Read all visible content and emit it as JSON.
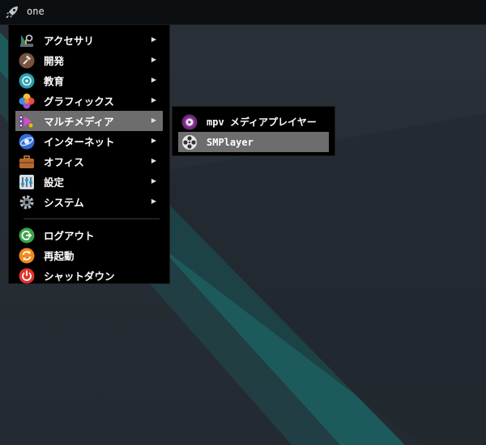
{
  "panel": {
    "launcher_icon": "rocket-icon",
    "label": "one"
  },
  "colors": {
    "menu_bg": "#000000",
    "highlight": "#6d6d6d",
    "desktop_bg": "#262d35",
    "stripe": "#1d5a5c"
  },
  "menu": {
    "items": [
      {
        "label": "アクセサリ",
        "icon": "accessories-icon",
        "submenu": true
      },
      {
        "label": "開発",
        "icon": "development-icon",
        "submenu": true
      },
      {
        "label": "教育",
        "icon": "education-icon",
        "submenu": true
      },
      {
        "label": "グラフィックス",
        "icon": "graphics-icon",
        "submenu": true
      },
      {
        "label": "マルチメディア",
        "icon": "multimedia-icon",
        "submenu": true,
        "highlighted": true
      },
      {
        "label": "インターネット",
        "icon": "internet-icon",
        "submenu": true
      },
      {
        "label": "オフィス",
        "icon": "office-icon",
        "submenu": true
      },
      {
        "label": "設定",
        "icon": "settings-icon",
        "submenu": true
      },
      {
        "label": "システム",
        "icon": "system-icon",
        "submenu": true
      }
    ],
    "actions": [
      {
        "label": "ログアウト",
        "icon": "logout-icon"
      },
      {
        "label": "再起動",
        "icon": "restart-icon"
      },
      {
        "label": "シャットダウン",
        "icon": "shutdown-icon"
      }
    ],
    "arrow": "▶"
  },
  "submenu": {
    "items": [
      {
        "label": "mpv メディアプレイヤー",
        "icon": "mpv-icon"
      },
      {
        "label": "SMPlayer",
        "icon": "smplayer-icon",
        "highlighted": true
      }
    ]
  }
}
